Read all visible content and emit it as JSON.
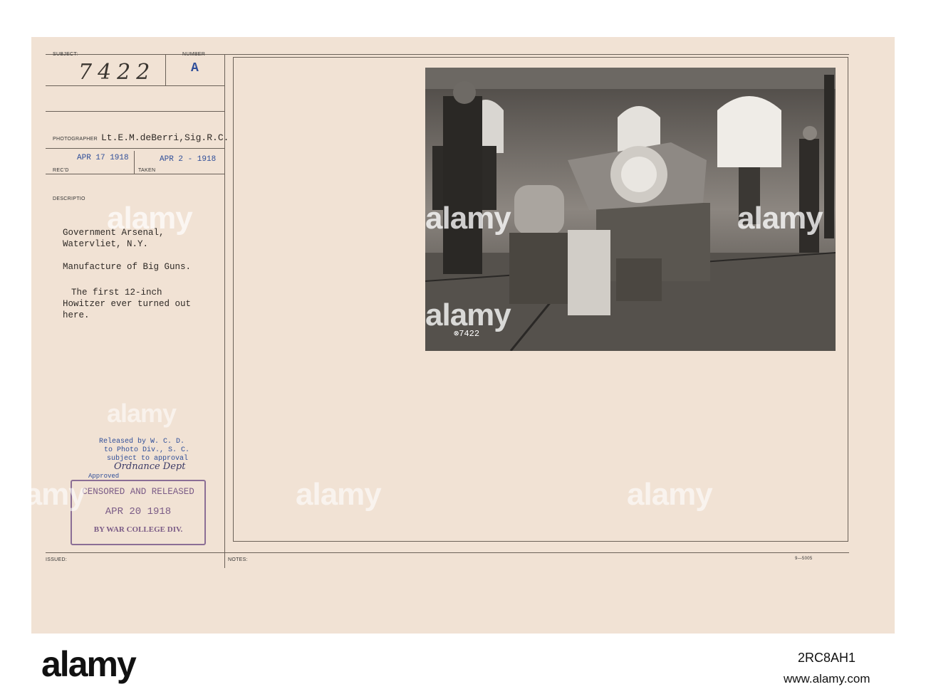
{
  "card": {
    "labels": {
      "subject": "SUBJECT:",
      "number": "NUMBER",
      "photographer": "PHOTOGRAPHER",
      "recd": "REC'D",
      "taken": "TAKEN",
      "description": "DESCRIPTIO",
      "issued": "ISSUED:",
      "notes": "NOTES:"
    },
    "subject_number": "7422",
    "number_letter": "A",
    "photographer_name": "Lt.E.M.deBerri,Sig.R.C.",
    "received_date": "APR 17 1918",
    "taken_date": "APR 2 - 1918",
    "description_lines": [
      "Government Arsenal,",
      "Watervliet, N.Y.",
      "Manufacture of Big Guns.",
      "The first 12-inch",
      "Howitzer ever turned out",
      "here."
    ],
    "release_stamp": {
      "line1": "Released by W. C. D.",
      "line2": "to Photo Div., S. C.",
      "line3": "subject to approval",
      "signature": "Ordnance Dept",
      "approved": "Approved"
    },
    "censor_stamp": {
      "line1": "CENSORED AND RELEASED",
      "date": "APR 20 1918",
      "line3": "BY WAR COLLEGE DIV."
    },
    "form_code": "9—5005",
    "photo_caption": "⊗7422"
  },
  "watermark": {
    "text": "alamy",
    "image_id": "2RC8AH1",
    "site": "www.alamy.com"
  },
  "colors": {
    "card": "#f1e2d4",
    "stamp_blue": "#2f4e99",
    "stamp_purple": "#7a5b86",
    "ink": "#2f2a26"
  }
}
